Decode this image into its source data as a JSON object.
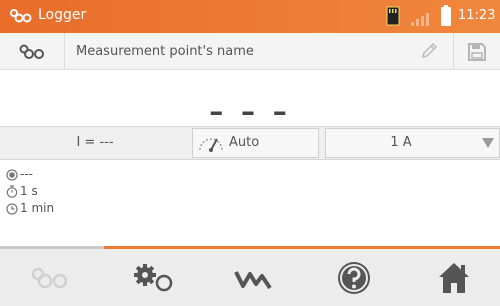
{
  "header": {
    "title": "Logger",
    "time": "11:23",
    "icons": [
      "logger-icon",
      "sd-card-icon",
      "signal-icon",
      "battery-icon"
    ]
  },
  "name_bar": {
    "placeholder": "Measurement point's name",
    "icons": [
      "logger-icon",
      "pencil-icon",
      "save-icon"
    ]
  },
  "reading": {
    "value": "– – –"
  },
  "params": {
    "current": "I = ---",
    "mode": "Auto",
    "range": "1 A"
  },
  "info": {
    "status": "---",
    "interval": "1 s",
    "duration": "1 min"
  },
  "bottom_nav": {
    "items": [
      "logger-icon",
      "settings-icon",
      "graph-icon",
      "help-icon",
      "home-icon"
    ]
  },
  "colors": {
    "accent": "#ec7b33",
    "background": "#ffffff",
    "bar": "#ececec"
  }
}
